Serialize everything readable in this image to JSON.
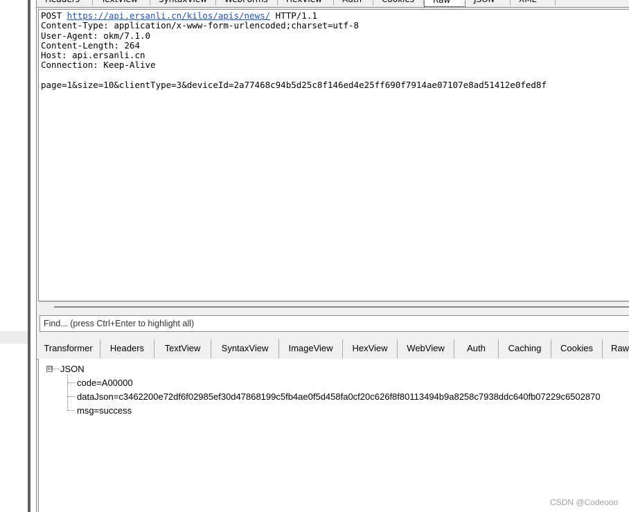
{
  "request_tabs": [
    "Headers",
    "TextView",
    "SyntaxView",
    "WebForms",
    "HexView",
    "Auth",
    "Cookies",
    "Raw",
    "JSON",
    "XML"
  ],
  "raw_request": {
    "line1_prefix": "POST ",
    "line1_url": "https://api.ersanli.cn/kilos/apis/news/",
    "line1_suffix": " HTTP/1.1",
    "headers": [
      "Content-Type: application/x-www-form-urlencoded;charset=utf-8",
      "User-Agent: okm/7.1.0",
      "Content-Length: 264",
      "Host: api.ersanli.cn",
      "Connection: Keep-Alive"
    ],
    "body": "page=1&size=10&clientType=3&deviceId=2a77468c94b5d25c8f146ed4e25ff690f7914ae07107e8ad51412e0fed8f"
  },
  "find": {
    "placeholder": "Find... (press Ctrl+Enter to highlight all)"
  },
  "response_tabs": [
    {
      "label": "Transformer"
    },
    {
      "label": "Headers"
    },
    {
      "label": "TextView"
    },
    {
      "label": "SyntaxView"
    },
    {
      "label": "ImageView"
    },
    {
      "label": "HexView"
    },
    {
      "label": "WebView"
    },
    {
      "label": "Auth"
    },
    {
      "label": "Caching"
    },
    {
      "label": "Cookies"
    },
    {
      "label": "Raw"
    }
  ],
  "json_tree": {
    "expander": "⊟",
    "root": "JSON",
    "children": [
      "code=A00000",
      "dataJson=c3462200e72df6f02985ef30d47868199c5fb4ae0f5d458fa0cf20c626f8f80113494b9a8258c7938ddc640fb07229c6502870",
      "msg=success"
    ]
  },
  "watermark": "CSDN @Codeooo"
}
